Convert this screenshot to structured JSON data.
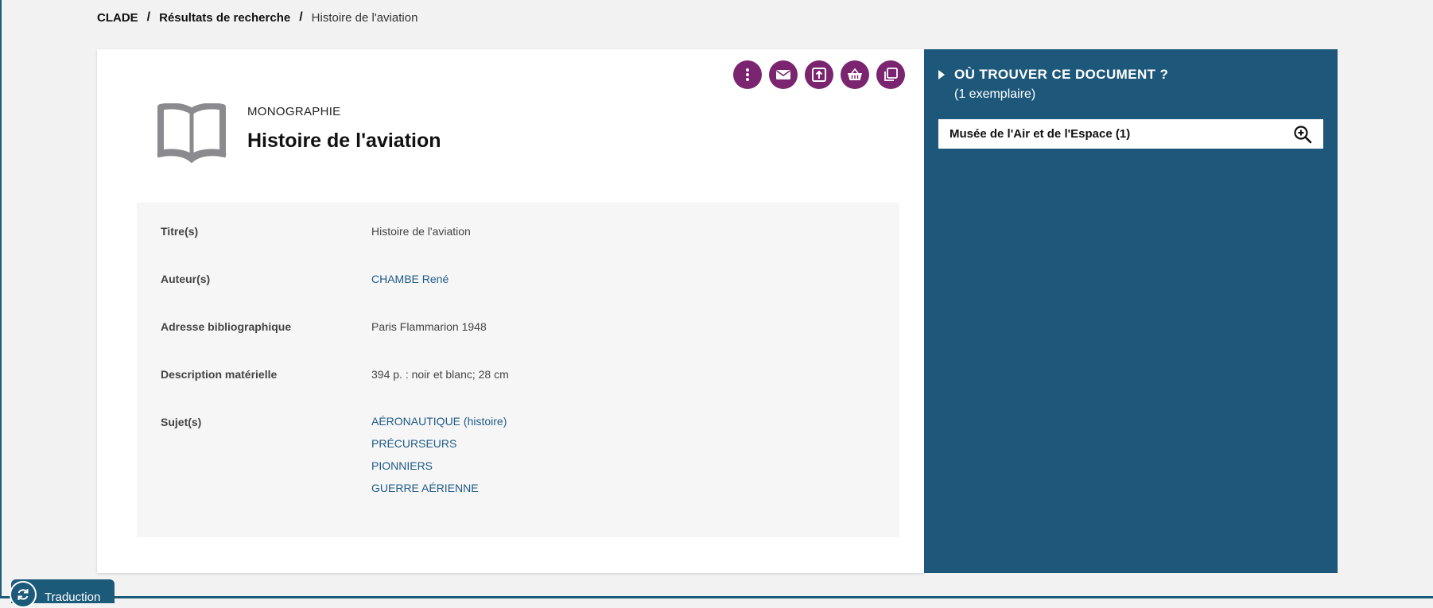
{
  "breadcrumb": {
    "home": "CLADE",
    "search_results": "Résultats de recherche",
    "current": "Histoire de l'aviation",
    "separator": "/"
  },
  "actions": [
    {
      "name": "more-options",
      "icon": "more-vertical-icon"
    },
    {
      "name": "email",
      "icon": "envelope-icon"
    },
    {
      "name": "export",
      "icon": "export-icon"
    },
    {
      "name": "basket",
      "icon": "basket-icon"
    },
    {
      "name": "copy",
      "icon": "copy-icon"
    }
  ],
  "document": {
    "type": "MONOGRAPHIE",
    "title": "Histoire de l'aviation",
    "icon": "book-icon"
  },
  "details": {
    "titles_label": "Titre(s)",
    "titles_value": "Histoire de l'aviation",
    "authors_label": "Auteur(s)",
    "author": "CHAMBE René",
    "address_label": "Adresse bibliographique",
    "address_value": "Paris Flammarion 1948",
    "description_label": "Description matérielle",
    "description_value": "394 p. : noir et blanc; 28 cm",
    "subjects_label": "Sujet(s)",
    "subjects": [
      "AÉRONAUTIQUE (histoire)",
      "PRÉCURSEURS",
      "PIONNIERS",
      "GUERRE AÉRIENNE"
    ]
  },
  "availability": {
    "title": "OÙ TROUVER CE DOCUMENT ?",
    "count": "(1 exemplaire)",
    "library": "Musée de l'Air et de l'Espace (1)",
    "zoom_icon": "zoom-in-icon"
  },
  "translate": {
    "label": "Traduction",
    "icon": "refresh-icon"
  },
  "colors": {
    "accent": "#7b2470",
    "panel": "#1d587b",
    "link": "#1f5a87"
  }
}
